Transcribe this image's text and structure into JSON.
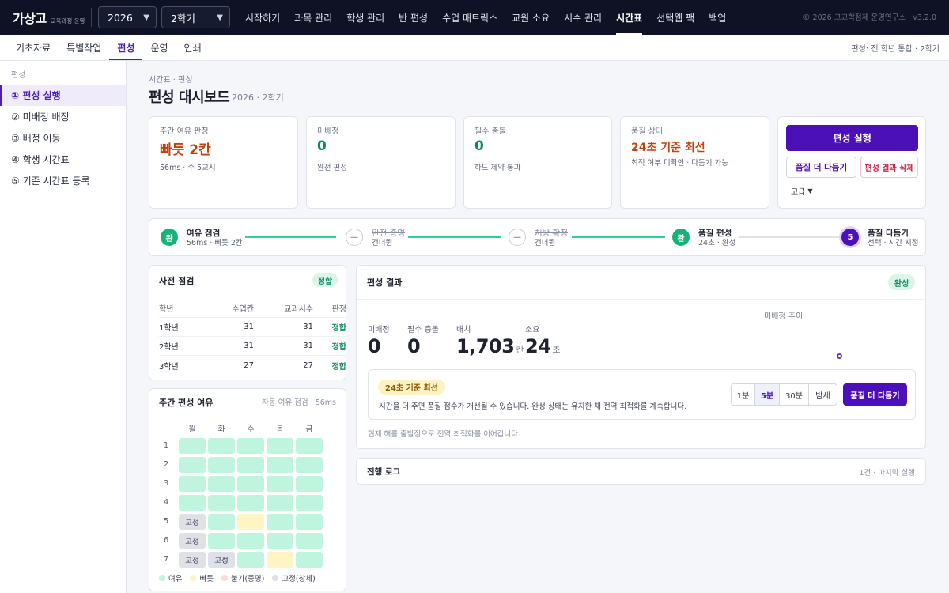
{
  "topbar": {
    "brand": "가상고",
    "brand_sub": "교육과정 운영",
    "year": "2026",
    "term": "2학기",
    "nav": [
      "시작하기",
      "과목 관리",
      "학생 관리",
      "반 편성",
      "수업 매트릭스",
      "교원 소요",
      "시수 관리",
      "시간표",
      "선택웹 팩",
      "백업"
    ],
    "active_nav": "시간표",
    "copyright": "© 2026 고교학점제 운영연구소 · v3.2.0"
  },
  "subnav": {
    "tabs": [
      "기초자료",
      "특별작업",
      "편성",
      "운영",
      "인쇄"
    ],
    "active": "편성",
    "right_text": "편성: 전 학년 통합 · 2학기"
  },
  "sidebar": {
    "heading": "편성",
    "items": [
      "① 편성 실행",
      "② 미배정 배정",
      "③ 배정 이동",
      "④ 학생 시간표",
      "⑤ 기존 시간표 등록"
    ],
    "active_index": 0
  },
  "page": {
    "breadcrumb": "시간표 · 편성",
    "title": "편성 대시보드",
    "subtitle": "2026 · 2학기"
  },
  "kpis": [
    {
      "label": "주간 여유 판정",
      "value": "빠듯 2칸",
      "note": "56ms · 수 5교시",
      "tone": "orange"
    },
    {
      "label": "미배정",
      "value": "0",
      "note": "완전 편성",
      "tone": "green"
    },
    {
      "label": "필수 충돌",
      "value": "0",
      "note": "하드 제약 통과",
      "tone": "green"
    },
    {
      "label": "품질 상태",
      "value": "24초 기준 최선",
      "note": "최적 여부 미확인 · 다듬기 가능",
      "tone": "orange"
    }
  ],
  "actions": {
    "run": "편성 실행",
    "refine": "품질 더 다듬기",
    "delete": "편성 결과 삭제",
    "advanced": "고급"
  },
  "steps": [
    {
      "mark": "완",
      "title": "여유 점검",
      "sub": "56ms · 빠듯 2칸",
      "state": "done"
    },
    {
      "mark": "—",
      "title": "완전 증명",
      "sub": "건너뜀",
      "state": "skip"
    },
    {
      "mark": "—",
      "title": "처방·확정",
      "sub": "건너뜀",
      "state": "skip"
    },
    {
      "mark": "완",
      "title": "품질 편성",
      "sub": "24초 · 완성",
      "state": "done"
    },
    {
      "mark": "5",
      "title": "품질 다듬기",
      "sub": "선택 · 시간 지정",
      "state": "current"
    }
  ],
  "precheck": {
    "title": "사전 점검",
    "badge": "정합",
    "columns": [
      "학년",
      "수업칸",
      "교과시수",
      "판정"
    ],
    "rows": [
      [
        "1학년",
        "31",
        "31",
        "정합"
      ],
      [
        "2학년",
        "31",
        "31",
        "정합"
      ],
      [
        "3학년",
        "27",
        "27",
        "정합"
      ]
    ]
  },
  "slack": {
    "title": "주간 편성 여유",
    "right": "자동 여유 점검 · 56ms",
    "days": [
      "월",
      "화",
      "수",
      "목",
      "금"
    ],
    "periods": [
      "1",
      "2",
      "3",
      "4",
      "5",
      "6",
      "7"
    ],
    "cells": [
      [
        "free",
        "free",
        "free",
        "free",
        "free"
      ],
      [
        "free",
        "free",
        "free",
        "free",
        "free"
      ],
      [
        "free",
        "free",
        "free",
        "free",
        "free"
      ],
      [
        "free",
        "free",
        "free",
        "free",
        "free"
      ],
      [
        "fixed",
        "free",
        "tight",
        "free",
        "free"
      ],
      [
        "fixed",
        "free",
        "free",
        "free",
        "free"
      ],
      [
        "fixed",
        "fixed",
        "free",
        "tight",
        "free"
      ]
    ],
    "fixed_label": "고정",
    "legend": [
      {
        "label": "여유",
        "color": "#bff5df"
      },
      {
        "label": "빠듯",
        "color": "#fdf5c4"
      },
      {
        "label": "불가(증명)",
        "color": "#fbd9df"
      },
      {
        "label": "고정(창체)",
        "color": "#dfe1e7"
      }
    ]
  },
  "result": {
    "title": "편성 결과",
    "badge": "완성",
    "trend_label": "미배정 추이",
    "stats": [
      {
        "label": "미배정",
        "value": "0",
        "unit": "",
        "tone": "green"
      },
      {
        "label": "필수 충돌",
        "value": "0",
        "unit": "",
        "tone": ""
      },
      {
        "label": "배치",
        "value": "1,703",
        "unit": "칸",
        "tone": ""
      },
      {
        "label": "소요",
        "value": "24",
        "unit": "초",
        "tone": ""
      }
    ],
    "chip": "24초 기준 최선",
    "message": "시간을 더 주면 품질 점수가 개선될 수 있습니다. 완성 상태는 유지한 채 전역 최적화를 계속합니다.",
    "durations": [
      "1분",
      "5분",
      "30분",
      "밤새"
    ],
    "selected_duration": "5분",
    "refine_button": "품질 더 다듬기",
    "footnote": "현재 해를 출발점으로 전역 최적화를 이어갑니다."
  },
  "log": {
    "title": "진행 로그",
    "right": "1건 · 마지막 실행"
  }
}
